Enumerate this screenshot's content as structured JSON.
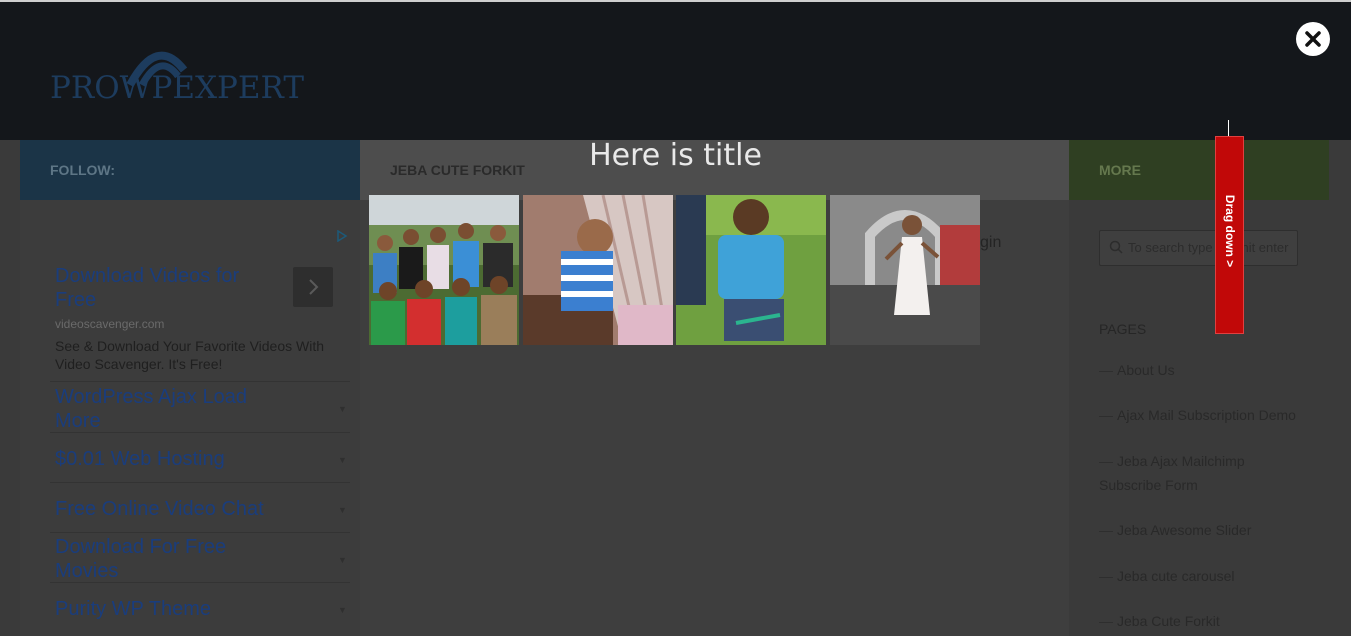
{
  "site": {
    "logo_text": "PROWPEXPERT"
  },
  "nav": {
    "follow_label": "FOLLOW:",
    "post_title": "JEBA CUTE FORKIT",
    "more_label": "MORE"
  },
  "ad": {
    "title": "Download Videos for Free",
    "url": "videoscavenger.com",
    "description": "See & Download Your Favorite Videos With Video Scavenger. It's Free!",
    "links": [
      "WordPress Ajax Load More",
      "$0.01 Web Hosting",
      "Free Online Video Chat",
      "Download For Free Movies",
      "Purity WP Theme"
    ]
  },
  "content": {
    "partial_text": "gin"
  },
  "sidebar": {
    "search_placeholder": "To search type and hit enter",
    "pages_heading": "PAGES",
    "pages": [
      "About Us",
      "Ajax Mail Subscription Demo",
      "Jeba Ajax Mailchimp Subscribe Form",
      "Jeba Awesome Slider",
      "Jeba cute carousel",
      "Jeba Cute Forkit"
    ]
  },
  "lightbox": {
    "title": "Here is title",
    "images": [
      "group-photo",
      "child-striped-shirt",
      "man-on-grass",
      "girl-white-dress"
    ]
  },
  "drag_tab": {
    "label": "Drag down >"
  },
  "colors": {
    "overlay": "#3a3a3a",
    "drag_tab": "#c10808",
    "link_blue": "#1a3d7c"
  }
}
